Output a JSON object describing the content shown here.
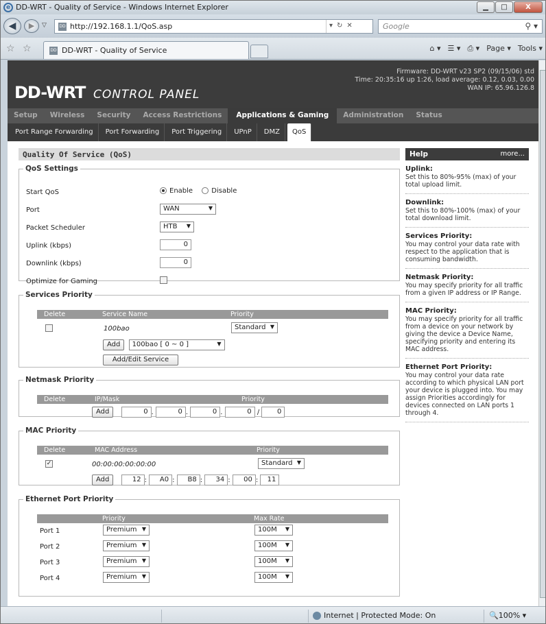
{
  "window": {
    "title": "DD-WRT - Quality of Service - Windows Internet Explorer"
  },
  "browser": {
    "url": "http://192.168.1.1/QoS.asp",
    "search_placeholder": "Google",
    "tab_label": "DD-WRT - Quality of Service",
    "cmd_page": "Page ▾",
    "cmd_tools": "Tools ▾",
    "zone": "Internet | Protected Mode: On",
    "zoom": "100%"
  },
  "router": {
    "logo": "DD-WRT",
    "subtitle": "CONTROL PANEL",
    "firmware": "Firmware: DD-WRT v23 SP2 (09/15/06) std",
    "time": "Time: 20:35:16 up 1:26, load average: 0.12, 0.03, 0.00",
    "wanip": "WAN IP: 65.96.126.8",
    "menu": [
      "Setup",
      "Wireless",
      "Security",
      "Access Restrictions",
      "Applications & Gaming",
      "Administration",
      "Status"
    ],
    "submenu": [
      "Port Range Forwarding",
      "Port Forwarding",
      "Port Triggering",
      "UPnP",
      "DMZ",
      "QoS"
    ]
  },
  "main": {
    "title": "Quality Of Service (QoS)",
    "qos": {
      "legend": "QoS Settings",
      "start_label": "Start QoS",
      "enable": "Enable",
      "disable": "Disable",
      "port_label": "Port",
      "port_val": "WAN",
      "sched_label": "Packet Scheduler",
      "sched_val": "HTB",
      "uplink_label": "Uplink (kbps)",
      "uplink_val": "0",
      "downlink_label": "Downlink (kbps)",
      "downlink_val": "0",
      "gaming_label": "Optimize for Gaming"
    },
    "services": {
      "legend": "Services Priority",
      "h_delete": "Delete",
      "h_name": "Service Name",
      "h_priority": "Priority",
      "row_name": "100bao",
      "row_priority": "Standard",
      "add": "Add",
      "add_sel": "100bao [ 0 ~ 0 ]",
      "edit": "Add/Edit Service"
    },
    "netmask": {
      "legend": "Netmask Priority",
      "h_delete": "Delete",
      "h_ipmask": "IP/Mask",
      "h_priority": "Priority",
      "add": "Add",
      "ip": [
        "0",
        "0",
        "0",
        "0"
      ],
      "mask": "0"
    },
    "mac": {
      "legend": "MAC Priority",
      "h_delete": "Delete",
      "h_mac": "MAC Address",
      "h_priority": "Priority",
      "row_mac": "00:00:00:00:00:00",
      "row_priority": "Standard",
      "add": "Add",
      "mac": [
        "12",
        "A0",
        "B8",
        "34",
        "00",
        "11"
      ]
    },
    "ethernet": {
      "legend": "Ethernet Port Priority",
      "h_priority": "Priority",
      "h_rate": "Max Rate",
      "ports": [
        {
          "name": "Port 1",
          "priority": "Premium",
          "rate": "100M"
        },
        {
          "name": "Port 2",
          "priority": "Premium",
          "rate": "100M"
        },
        {
          "name": "Port 3",
          "priority": "Premium",
          "rate": "100M"
        },
        {
          "name": "Port 4",
          "priority": "Premium",
          "rate": "100M"
        }
      ]
    }
  },
  "help": {
    "title": "Help",
    "more": "more...",
    "items": [
      {
        "t": "Uplink:",
        "d": "Set this to 80%-95% (max) of your total upload limit."
      },
      {
        "t": "Downlink:",
        "d": "Set this to 80%-100% (max) of your total download limit."
      },
      {
        "t": "Services Priority:",
        "d": "You may control your data rate with respect to the application that is consuming bandwidth."
      },
      {
        "t": "Netmask Priority:",
        "d": "You may specify priority for all traffic from a given IP address or IP Range."
      },
      {
        "t": "MAC Priority:",
        "d": "You may specify priority for all traffic from a device on your network by giving the device a Device Name, specifying priority and entering its MAC address."
      },
      {
        "t": "Ethernet Port Priority:",
        "d": "You may control your data rate according to which physical LAN port your device is plugged into. You may assign Priorities accordingly for devices connected on LAN ports 1 through 4."
      }
    ]
  }
}
